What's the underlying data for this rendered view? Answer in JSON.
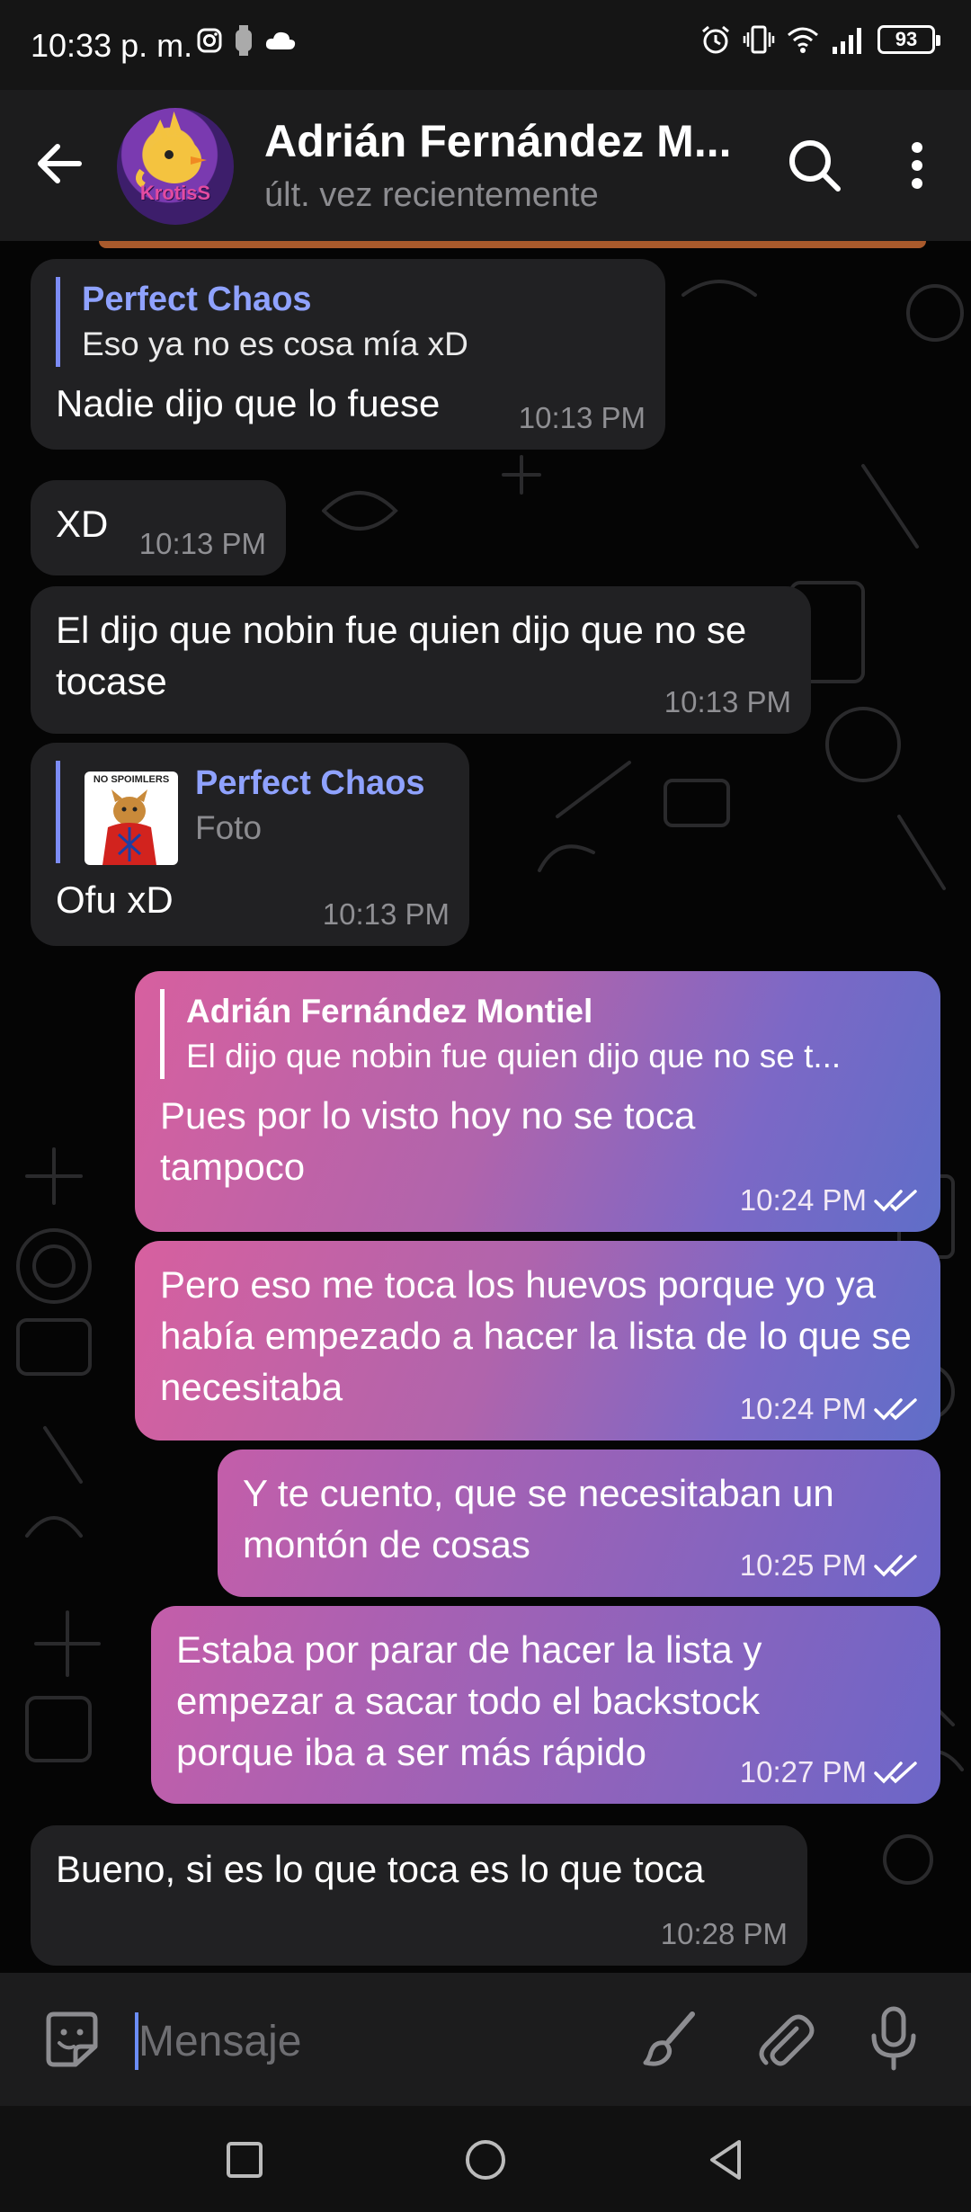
{
  "status_bar": {
    "time": "10:33 p. m.",
    "battery": "93",
    "left_icons": [
      "instagram-icon",
      "watch-icon",
      "cloud-icon"
    ],
    "right_icons": [
      "alarm-icon",
      "vibrate-icon",
      "wifi-icon",
      "signal-icon",
      "battery-icon"
    ]
  },
  "header": {
    "title": "Adrián Fernández M...",
    "status": "últ. vez recientemente",
    "avatar_text": "KrotisS"
  },
  "messages": [
    {
      "direction": "in",
      "reply_name": "Perfect Chaos",
      "reply_text": "Eso ya no es cosa mía xD",
      "text": "Nadie dijo que lo fuese",
      "time": "10:13 PM"
    },
    {
      "direction": "in",
      "text": "XD",
      "time": "10:13 PM"
    },
    {
      "direction": "in",
      "text": "El dijo que nobin fue quien dijo que no se tocase",
      "time": "10:13 PM"
    },
    {
      "direction": "in",
      "reply_name": "Perfect Chaos",
      "reply_text": "Foto",
      "reply_thumb_text": "NO SPOIMLERS",
      "text": "Ofu xD",
      "time": "10:13 PM"
    },
    {
      "direction": "out",
      "reply_name": "Adrián Fernández Montiel",
      "reply_text": "El dijo que nobin fue quien dijo que no se t...",
      "text": "Pues por lo visto hoy no se toca tampoco",
      "time": "10:24 PM"
    },
    {
      "direction": "out",
      "text": "Pero eso me toca los huevos porque yo ya había empezado a hacer la lista de lo que se necesitaba",
      "time": "10:24 PM"
    },
    {
      "direction": "out",
      "text": "Y te cuento, que se necesitaban un montón de cosas",
      "time": "10:25 PM"
    },
    {
      "direction": "out",
      "text": "Estaba por parar de hacer la lista y empezar a sacar todo el backstock porque iba a ser más rápido",
      "time": "10:27 PM"
    },
    {
      "direction": "in",
      "text": "Bueno, si es lo que toca es lo que toca",
      "time": "10:28 PM"
    }
  ],
  "input": {
    "placeholder": "Mensaje"
  },
  "colors": {
    "incoming_bubble": "#212123",
    "outgoing_gradient_start": "#d7609f",
    "outgoing_gradient_end": "#5f6ec8",
    "reply_name": "#8fa2ff",
    "header_bg": "#1c1c1d"
  }
}
